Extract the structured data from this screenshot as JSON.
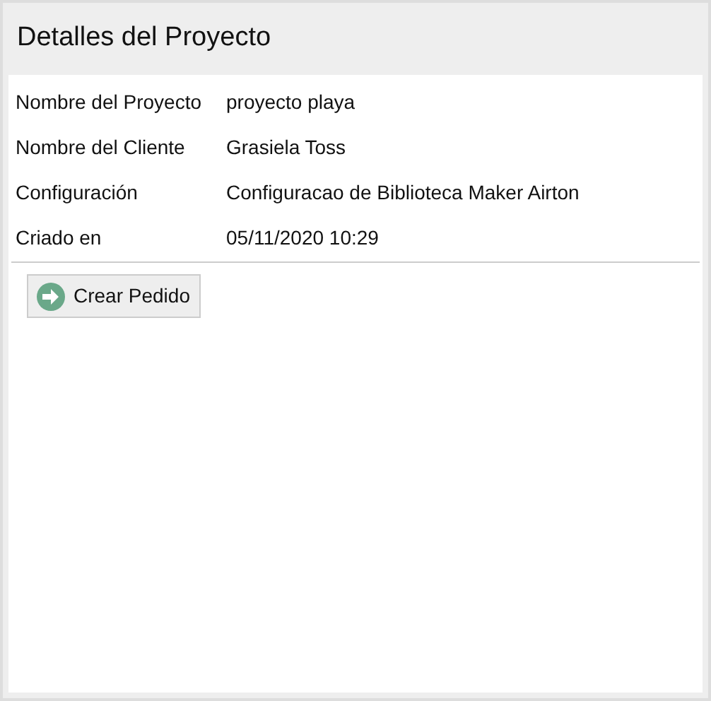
{
  "header": {
    "title": "Detalles del Proyecto"
  },
  "details": [
    {
      "label": "Nombre del Proyecto",
      "value": "proyecto playa"
    },
    {
      "label": "Nombre del Cliente",
      "value": "Grasiela Toss"
    },
    {
      "label": "Configuración",
      "value": "Configuracao de Biblioteca Maker Airton"
    },
    {
      "label": "Criado en",
      "value": "05/11/2020 10:29"
    }
  ],
  "actions": [
    {
      "label": "Crear Pedido"
    }
  ]
}
